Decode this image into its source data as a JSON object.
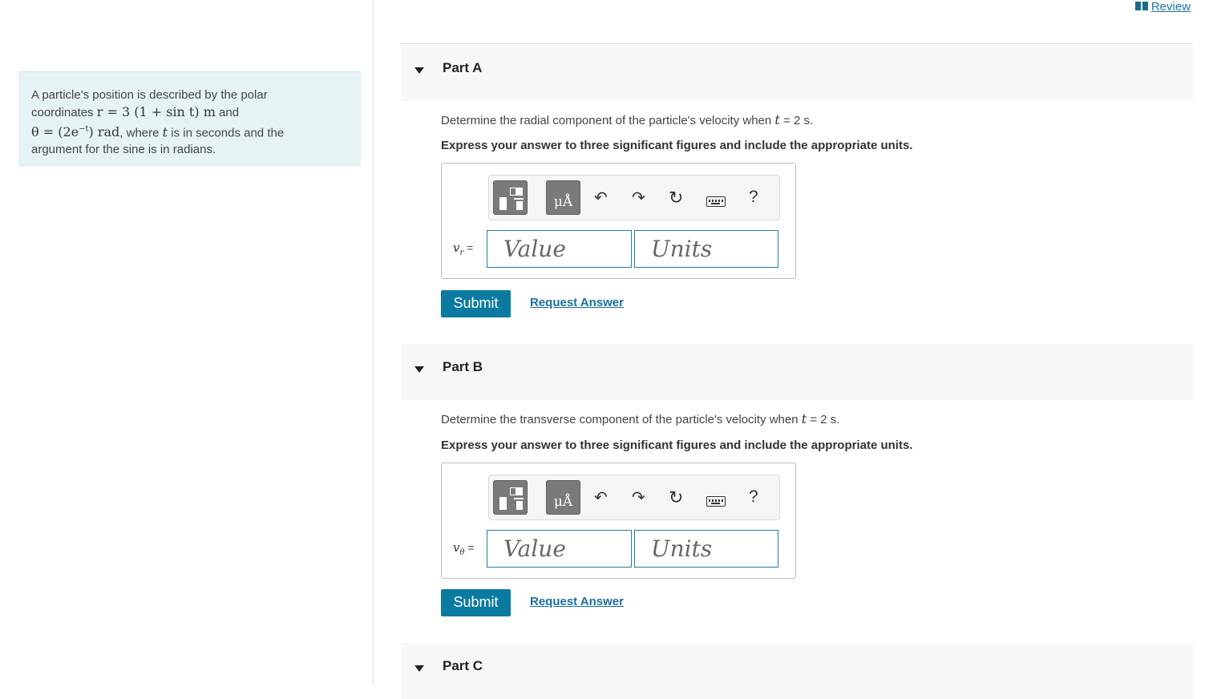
{
  "header": {
    "review_label": "Review"
  },
  "problem": {
    "line1": "A particle's position is described by the polar",
    "line2_pre": "coordinates ",
    "r_expr": "r = 3 (1 + sin t) m",
    "line2_post": " and",
    "theta_expr": "θ = (2e",
    "theta_sup": "−t",
    "theta_end": ") rad",
    "line3_mid": ", where ",
    "t_var": "t",
    "line3_post": " is in seconds and the",
    "line4": "argument for the sine is in radians."
  },
  "parts": [
    {
      "title": "Part A",
      "question_pre": "Determine the radial component of the particle's velocity when ",
      "question_var": "t",
      "question_post": " = 2 s.",
      "instruction": "Express your answer to three significant figures and include the appropriate units.",
      "var_label": "vr",
      "var_symbol": "v",
      "var_sub": "r",
      "value_placeholder": "Value",
      "units_placeholder": "Units",
      "submit_label": "Submit",
      "request_label": "Request Answer"
    },
    {
      "title": "Part B",
      "question_pre": "Determine the transverse component of the particle's velocity when ",
      "question_var": "t",
      "question_post": " = 2 s.",
      "instruction": "Express your answer to three significant figures and include the appropriate units.",
      "var_label": "vθ",
      "var_symbol": "v",
      "var_sub": "θ",
      "value_placeholder": "Value",
      "units_placeholder": "Units",
      "submit_label": "Submit",
      "request_label": "Request Answer"
    },
    {
      "title": "Part C"
    }
  ],
  "toolbar": {
    "units_glyph": "μÅ",
    "undo_glyph": "↶",
    "redo_glyph": "↷",
    "reset_glyph": "↻",
    "help_glyph": "?",
    "icons": [
      "templates-icon",
      "units-icon",
      "undo-icon",
      "redo-icon",
      "reset-icon",
      "keyboard-icon",
      "help-icon"
    ]
  },
  "colors": {
    "accent": "#0b7aa0",
    "link": "#1a6fa0",
    "problem_bg": "#e6f3f4",
    "field_border": "#1f7fa5"
  }
}
